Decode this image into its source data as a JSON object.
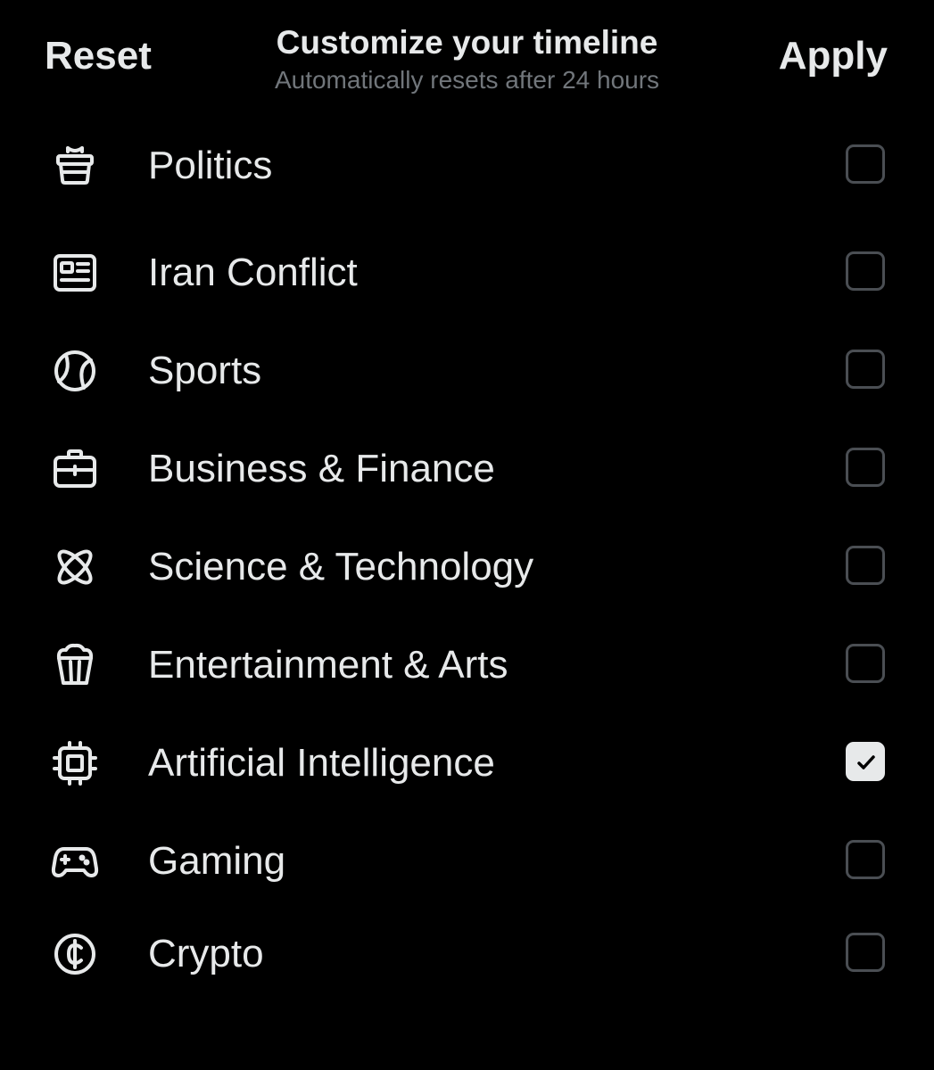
{
  "header": {
    "reset_label": "Reset",
    "title": "Customize your timeline",
    "subtitle": "Automatically resets after 24 hours",
    "apply_label": "Apply"
  },
  "topics": [
    {
      "label": "Politics",
      "icon": "podium-icon",
      "checked": false
    },
    {
      "label": "Iran Conflict",
      "icon": "newspaper-icon",
      "checked": false
    },
    {
      "label": "Sports",
      "icon": "ball-icon",
      "checked": false
    },
    {
      "label": "Business & Finance",
      "icon": "briefcase-icon",
      "checked": false
    },
    {
      "label": "Science & Technology",
      "icon": "atom-icon",
      "checked": false
    },
    {
      "label": "Entertainment & Arts",
      "icon": "popcorn-icon",
      "checked": false
    },
    {
      "label": "Artificial Intelligence",
      "icon": "chip-icon",
      "checked": true
    },
    {
      "label": "Gaming",
      "icon": "gamepad-icon",
      "checked": false
    },
    {
      "label": "Crypto",
      "icon": "cent-coin-icon",
      "checked": false
    }
  ],
  "colors": {
    "background": "#000000",
    "text": "#e7e9ea",
    "muted": "#71767b",
    "checkbox_border": "#4a4e53"
  }
}
